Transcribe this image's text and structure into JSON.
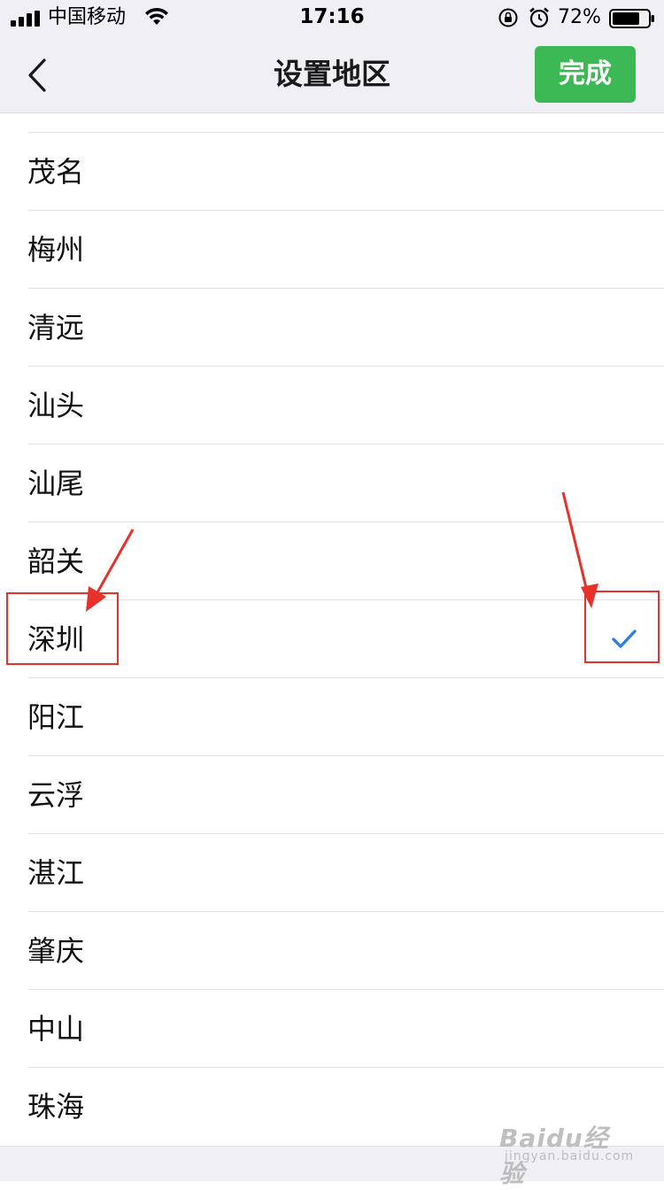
{
  "status_bar": {
    "carrier": "中国移动",
    "time": "17:16",
    "battery_percent": "72%"
  },
  "nav": {
    "title": "设置地区",
    "done_label": "完成"
  },
  "regions": [
    {
      "label": "茂名",
      "selected": false
    },
    {
      "label": "梅州",
      "selected": false
    },
    {
      "label": "清远",
      "selected": false
    },
    {
      "label": "汕头",
      "selected": false
    },
    {
      "label": "汕尾",
      "selected": false
    },
    {
      "label": "韶关",
      "selected": false
    },
    {
      "label": "深圳",
      "selected": true
    },
    {
      "label": "阳江",
      "selected": false
    },
    {
      "label": "云浮",
      "selected": false
    },
    {
      "label": "湛江",
      "selected": false
    },
    {
      "label": "肇庆",
      "selected": false
    },
    {
      "label": "中山",
      "selected": false
    },
    {
      "label": "珠海",
      "selected": false
    }
  ],
  "watermark": {
    "main": "Baidu经验",
    "sub": "jingyan.baidu.com"
  },
  "colors": {
    "accent_green": "#3cb954",
    "check_blue": "#2f7fe0",
    "annotation_red": "#e8312a"
  }
}
